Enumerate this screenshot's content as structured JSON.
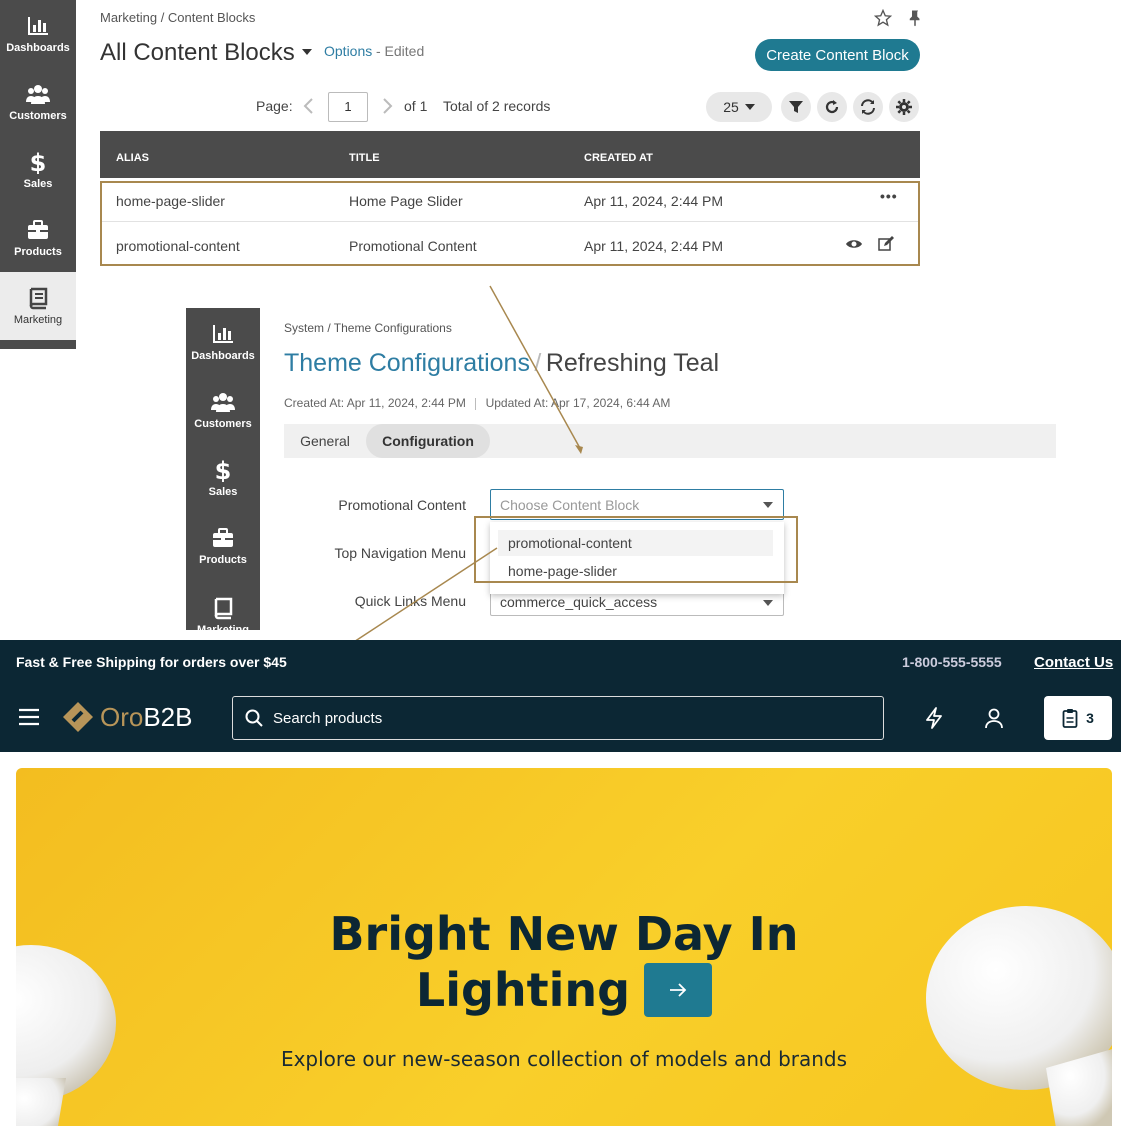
{
  "sidebar": {
    "items": [
      {
        "label": "Dashboards",
        "icon": "chart-icon"
      },
      {
        "label": "Customers",
        "icon": "users-icon"
      },
      {
        "label": "Sales",
        "icon": "dollar-icon"
      },
      {
        "label": "Products",
        "icon": "briefcase-icon"
      },
      {
        "label": "Marketing",
        "icon": "book-icon"
      }
    ]
  },
  "content_blocks": {
    "breadcrumb": "Marketing / Content Blocks",
    "title": "All Content Blocks",
    "options_label": "Options",
    "edited_label": "- Edited",
    "create_button": "Create Content Block",
    "pager": {
      "page_label": "Page:",
      "page": "1",
      "of_label": "of 1",
      "total": "Total of 2 records",
      "page_size": "25"
    },
    "columns": [
      "ALIAS",
      "TITLE",
      "CREATED AT"
    ],
    "rows": [
      {
        "alias": "home-page-slider",
        "title": "Home Page Slider",
        "created_at": "Apr 11, 2024, 2:44 PM"
      },
      {
        "alias": "promotional-content",
        "title": "Promotional Content",
        "created_at": "Apr 11, 2024, 2:44 PM"
      }
    ]
  },
  "theme_config": {
    "breadcrumb": "System / Theme Configurations",
    "title_link": "Theme Configurations",
    "title_sep": "/",
    "title_name": "Refreshing Teal",
    "meta_created": "Created At: Apr 11, 2024, 2:44 PM",
    "meta_updated": "Updated At: Apr 17, 2024, 6:44 AM",
    "tabs": [
      "General",
      "Configuration"
    ],
    "fields": {
      "promotional_content_label": "Promotional Content",
      "promotional_content_placeholder": "Choose Content Block",
      "top_nav_label": "Top Navigation Menu",
      "quick_links_label": "Quick Links Menu",
      "quick_links_value": "commerce_quick_access"
    },
    "dropdown_options": [
      "promotional-content",
      "home-page-slider"
    ]
  },
  "storefront": {
    "shipping_text": "Fast & Free Shipping for orders over $45",
    "phone": "1-800-555-5555",
    "contact": "Contact Us",
    "logo_text_a": "Oro",
    "logo_text_b": "B2B",
    "search_placeholder": "Search products",
    "cart_count": "3",
    "hero_title_line1": "Bright New Day In",
    "hero_title_line2": "Lighting",
    "hero_subtitle": "Explore our new-season collection of models and brands"
  },
  "colors": {
    "teal": "#1f7a91",
    "sidebar": "#4b4b4b",
    "highlight": "#a8884f",
    "storefront_dark": "#0c2734",
    "hero_yellow": "#f7c624"
  }
}
